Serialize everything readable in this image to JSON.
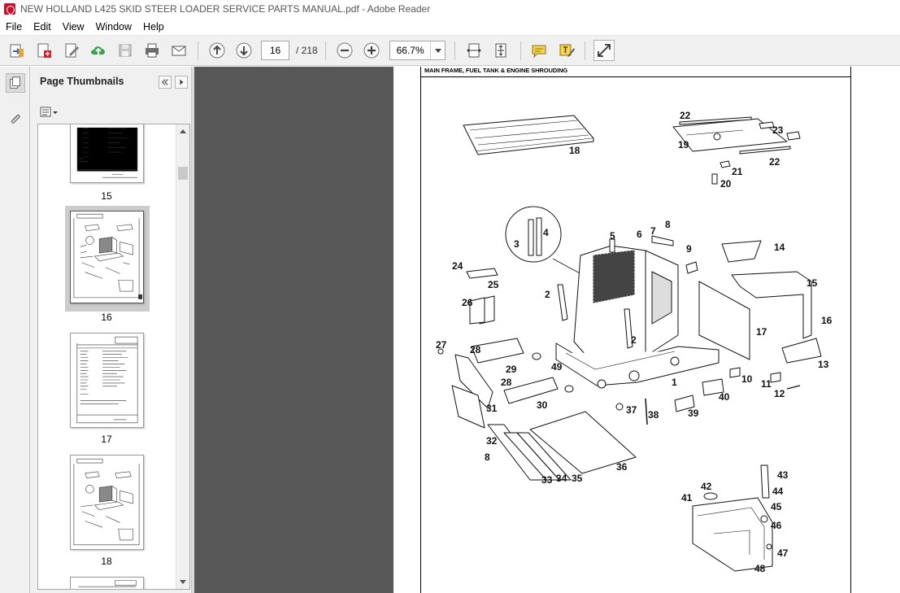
{
  "window": {
    "title": "NEW HOLLAND L425 SKID STEER LOADER SERVICE PARTS MANUAL.pdf - Adobe Reader"
  },
  "menu": [
    "File",
    "Edit",
    "View",
    "Window",
    "Help"
  ],
  "toolbar": {
    "current_page": "16",
    "total_pages": "/ 218",
    "zoom": "66.7%"
  },
  "nav_panel": {
    "title": "Page Thumbnails",
    "thumbnails": [
      {
        "label": "15",
        "selected": false
      },
      {
        "label": "16",
        "selected": true
      },
      {
        "label": "17",
        "selected": false
      },
      {
        "label": "18",
        "selected": false
      }
    ]
  },
  "document": {
    "header": "MAIN FRAME, FUEL TANK & ENGINE SHROUDING",
    "callouts": [
      "1",
      "2",
      "2",
      "3",
      "4",
      "5",
      "6",
      "7",
      "8",
      "8",
      "9",
      "10",
      "11",
      "12",
      "13",
      "14",
      "15",
      "16",
      "17",
      "18",
      "19",
      "20",
      "21",
      "22",
      "22",
      "23",
      "24",
      "25",
      "26",
      "27",
      "28",
      "28",
      "29",
      "30",
      "31",
      "32",
      "33",
      "34",
      "35",
      "36",
      "37",
      "38",
      "39",
      "40",
      "41",
      "42",
      "43",
      "44",
      "45",
      "46",
      "47",
      "48",
      "49"
    ]
  }
}
